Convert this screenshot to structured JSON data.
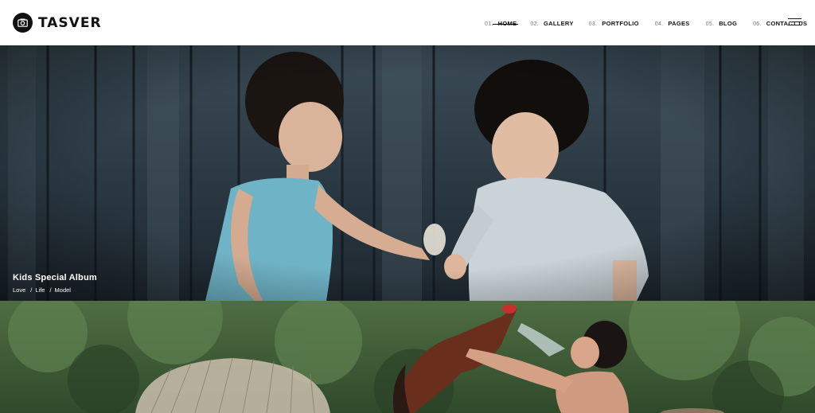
{
  "brand": {
    "name": "TASVER",
    "logo_icon": "camera-icon"
  },
  "nav": {
    "items": [
      {
        "num": "01.",
        "label": "HOME",
        "active": true
      },
      {
        "num": "02.",
        "label": "GALLERY"
      },
      {
        "num": "03.",
        "label": "PORTFOLIO"
      },
      {
        "num": "04.",
        "label": "PAGES"
      },
      {
        "num": "05.",
        "label": "BLOG"
      },
      {
        "num": "06.",
        "label": "CONTACT US"
      }
    ],
    "menu_icon": "hamburger-menu-icon"
  },
  "slides": [
    {
      "title": "Kids Special Album",
      "tags": [
        "Love",
        "Life",
        "Model"
      ]
    }
  ]
}
